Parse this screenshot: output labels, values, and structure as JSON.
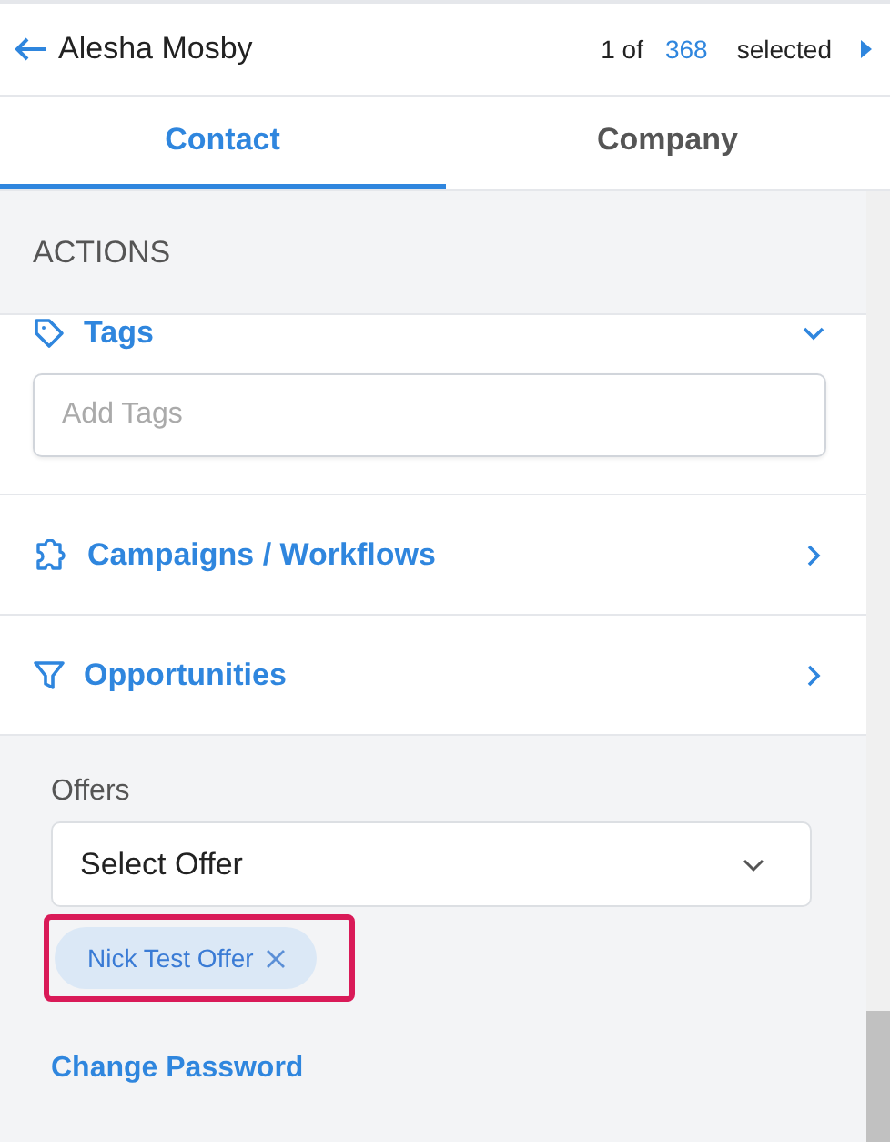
{
  "header": {
    "name": "Alesha Mosby",
    "count_prefix": "1 of",
    "count": "368",
    "count_suffix": "selected"
  },
  "tabs": [
    {
      "label": "Contact",
      "selected": true
    },
    {
      "label": "Company",
      "selected": false
    }
  ],
  "actions_title": "ACTIONS",
  "sections": [
    {
      "kind": "tag",
      "title": "Tags",
      "expanded": true,
      "placeholder": "Add Tags"
    },
    {
      "kind": "puzzle",
      "title": "Campaigns / Workflows",
      "expanded": false
    },
    {
      "kind": "filter",
      "title": "Opportunities",
      "expanded": false
    }
  ],
  "offers": {
    "label": "Offers",
    "select_placeholder": "Select Offer",
    "chips": [
      {
        "label": "Nick Test Offer",
        "highlighted": true
      }
    ]
  },
  "change_password": "Change Password"
}
